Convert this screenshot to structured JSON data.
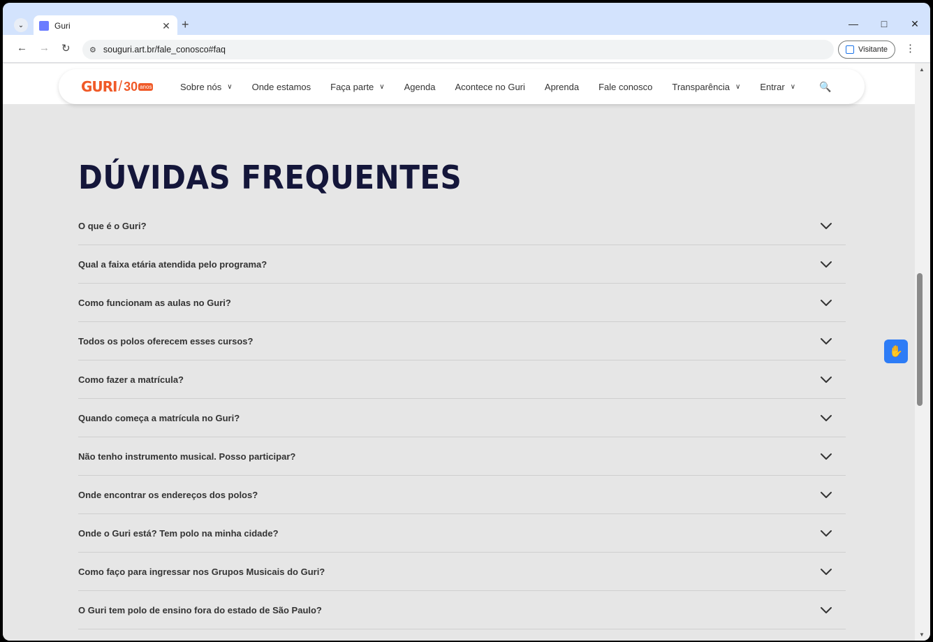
{
  "browser": {
    "tab_title": "Guri",
    "url": "souguri.art.br/fale_conosco#faq",
    "profile_label": "Visitante"
  },
  "nav": {
    "items": [
      {
        "label": "Sobre nós",
        "dropdown": true
      },
      {
        "label": "Onde estamos",
        "dropdown": false
      },
      {
        "label": "Faça parte",
        "dropdown": true
      },
      {
        "label": "Agenda",
        "dropdown": false
      },
      {
        "label": "Acontece no Guri",
        "dropdown": false
      },
      {
        "label": "Aprenda",
        "dropdown": false
      },
      {
        "label": "Fale conosco",
        "dropdown": false
      },
      {
        "label": "Transparência",
        "dropdown": true
      },
      {
        "label": "Entrar",
        "dropdown": true
      }
    ]
  },
  "logo": {
    "text": "GURI",
    "anniversary": "30",
    "anos": "anos"
  },
  "faq": {
    "title": "DÚVIDAS FREQUENTES",
    "questions": [
      "O que é o Guri?",
      "Qual a faixa etária atendida pelo programa?",
      "Como funcionam as aulas no Guri?",
      "Todos os polos oferecem esses cursos?",
      "Como fazer a matrícula?",
      "Quando começa a matrícula no Guri?",
      "Não tenho instrumento musical. Posso participar?",
      "Onde encontrar os endereços dos polos?",
      "Onde o Guri está? Tem polo na minha cidade?",
      "Como faço para ingressar nos Grupos Musicais do Guri?",
      "O Guri tem polo de ensino fora do estado de São Paulo?"
    ]
  },
  "colors": {
    "title": "#14163a",
    "brand": "#f05a28",
    "accessibility": "#2d7cf6"
  },
  "icons": {
    "accessibility": "hand-sign-language-icon"
  }
}
